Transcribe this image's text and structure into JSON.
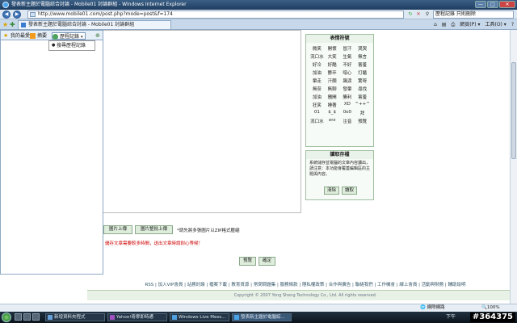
{
  "window": {
    "title": "發表新主題於電腦綜合討論 - Mobile01 討論群組 - Windows Internet Explorer",
    "buttons": {
      "minimize": "—",
      "maximize": "□",
      "close": "✕"
    }
  },
  "address_bar": {
    "url": "http://www.mobile01.com/post.php?mode=post&f=174",
    "search_value": "歷程記錄 只則刪除",
    "back": "◀",
    "forward": "▶"
  },
  "tabbar": {
    "tab_title": "發表新主題於電腦綜合討論 - Mobile01 討論群組",
    "tools": {
      "home": "⌂",
      "feeds": "▤",
      "print": "⎙",
      "page": "網頁(P) ▾",
      "tools": "工具(O) ▾",
      "help": "?"
    }
  },
  "favorites_panel": {
    "tabs": {
      "favorites": "我的最愛",
      "feeds": "摘要",
      "history": "歷程記錄"
    },
    "dropdown_item": "搜尋歷程記錄"
  },
  "emoticons": {
    "title": "表情符號",
    "items": [
      "微笑",
      "開懷",
      "冒汗",
      "哭哭",
      "流口水",
      "大笑",
      "生氣",
      "無言",
      "好冷",
      "好酷",
      "不好",
      "害羞",
      "加油",
      "鬱卒",
      "噁心",
      "打瞌",
      "暈走",
      "汗顏",
      "飆淚",
      "驚呀",
      "無奈",
      "無聊",
      "發暈",
      "尋找",
      "加油",
      "攤開",
      "勝利",
      "害羞",
      "狂笑",
      "睡著",
      "XD",
      "^++^",
      "01",
      "$_$",
      "0o0",
      "拜",
      "流口水",
      "orz",
      "注音",
      "預覽"
    ]
  },
  "drafts": {
    "title": "讀取存檔",
    "description": "系統儲存並電腦的文章內容讀出，請注意：本功能會覆蓋編輯區的主題與內容。",
    "clear_label": "清除",
    "load_label": "讀取"
  },
  "upload": {
    "image_upload_label": "圖片上傳",
    "batch_upload_label": "圖片整批上傳",
    "hint": "*請先將多張圖片以ZIP格式壓縮"
  },
  "warning": "儲存文章需要較多時間，送出文章時請耐心等候！",
  "submit": {
    "preview_label": "預覽",
    "confirm_label": "確定"
  },
  "footer": {
    "links": "RSS | 加入VIP會員 | 站務討論 | 檔案下載 | 教育資源 | 常問問題集 | 服務條款 | 隱私權政策 | 合作與廣告 | 聯絡我們 | 工作機會 | 線上會員 | 活動與財務 | 輔助說明",
    "copyright": "Copyright © 2007 Yong Sheng Technology Co., Ltd. All rights reserved."
  },
  "statusbar": {
    "zone": "網際網路",
    "zoom": "100%"
  },
  "taskbar": {
    "tasks": [
      "新增資料夾程式",
      "Yahoo!奇摩即時通",
      "Windows Live Mess...",
      "發表新主題於電腦綜..."
    ],
    "clock": "下午"
  },
  "watermark": "#364375"
}
